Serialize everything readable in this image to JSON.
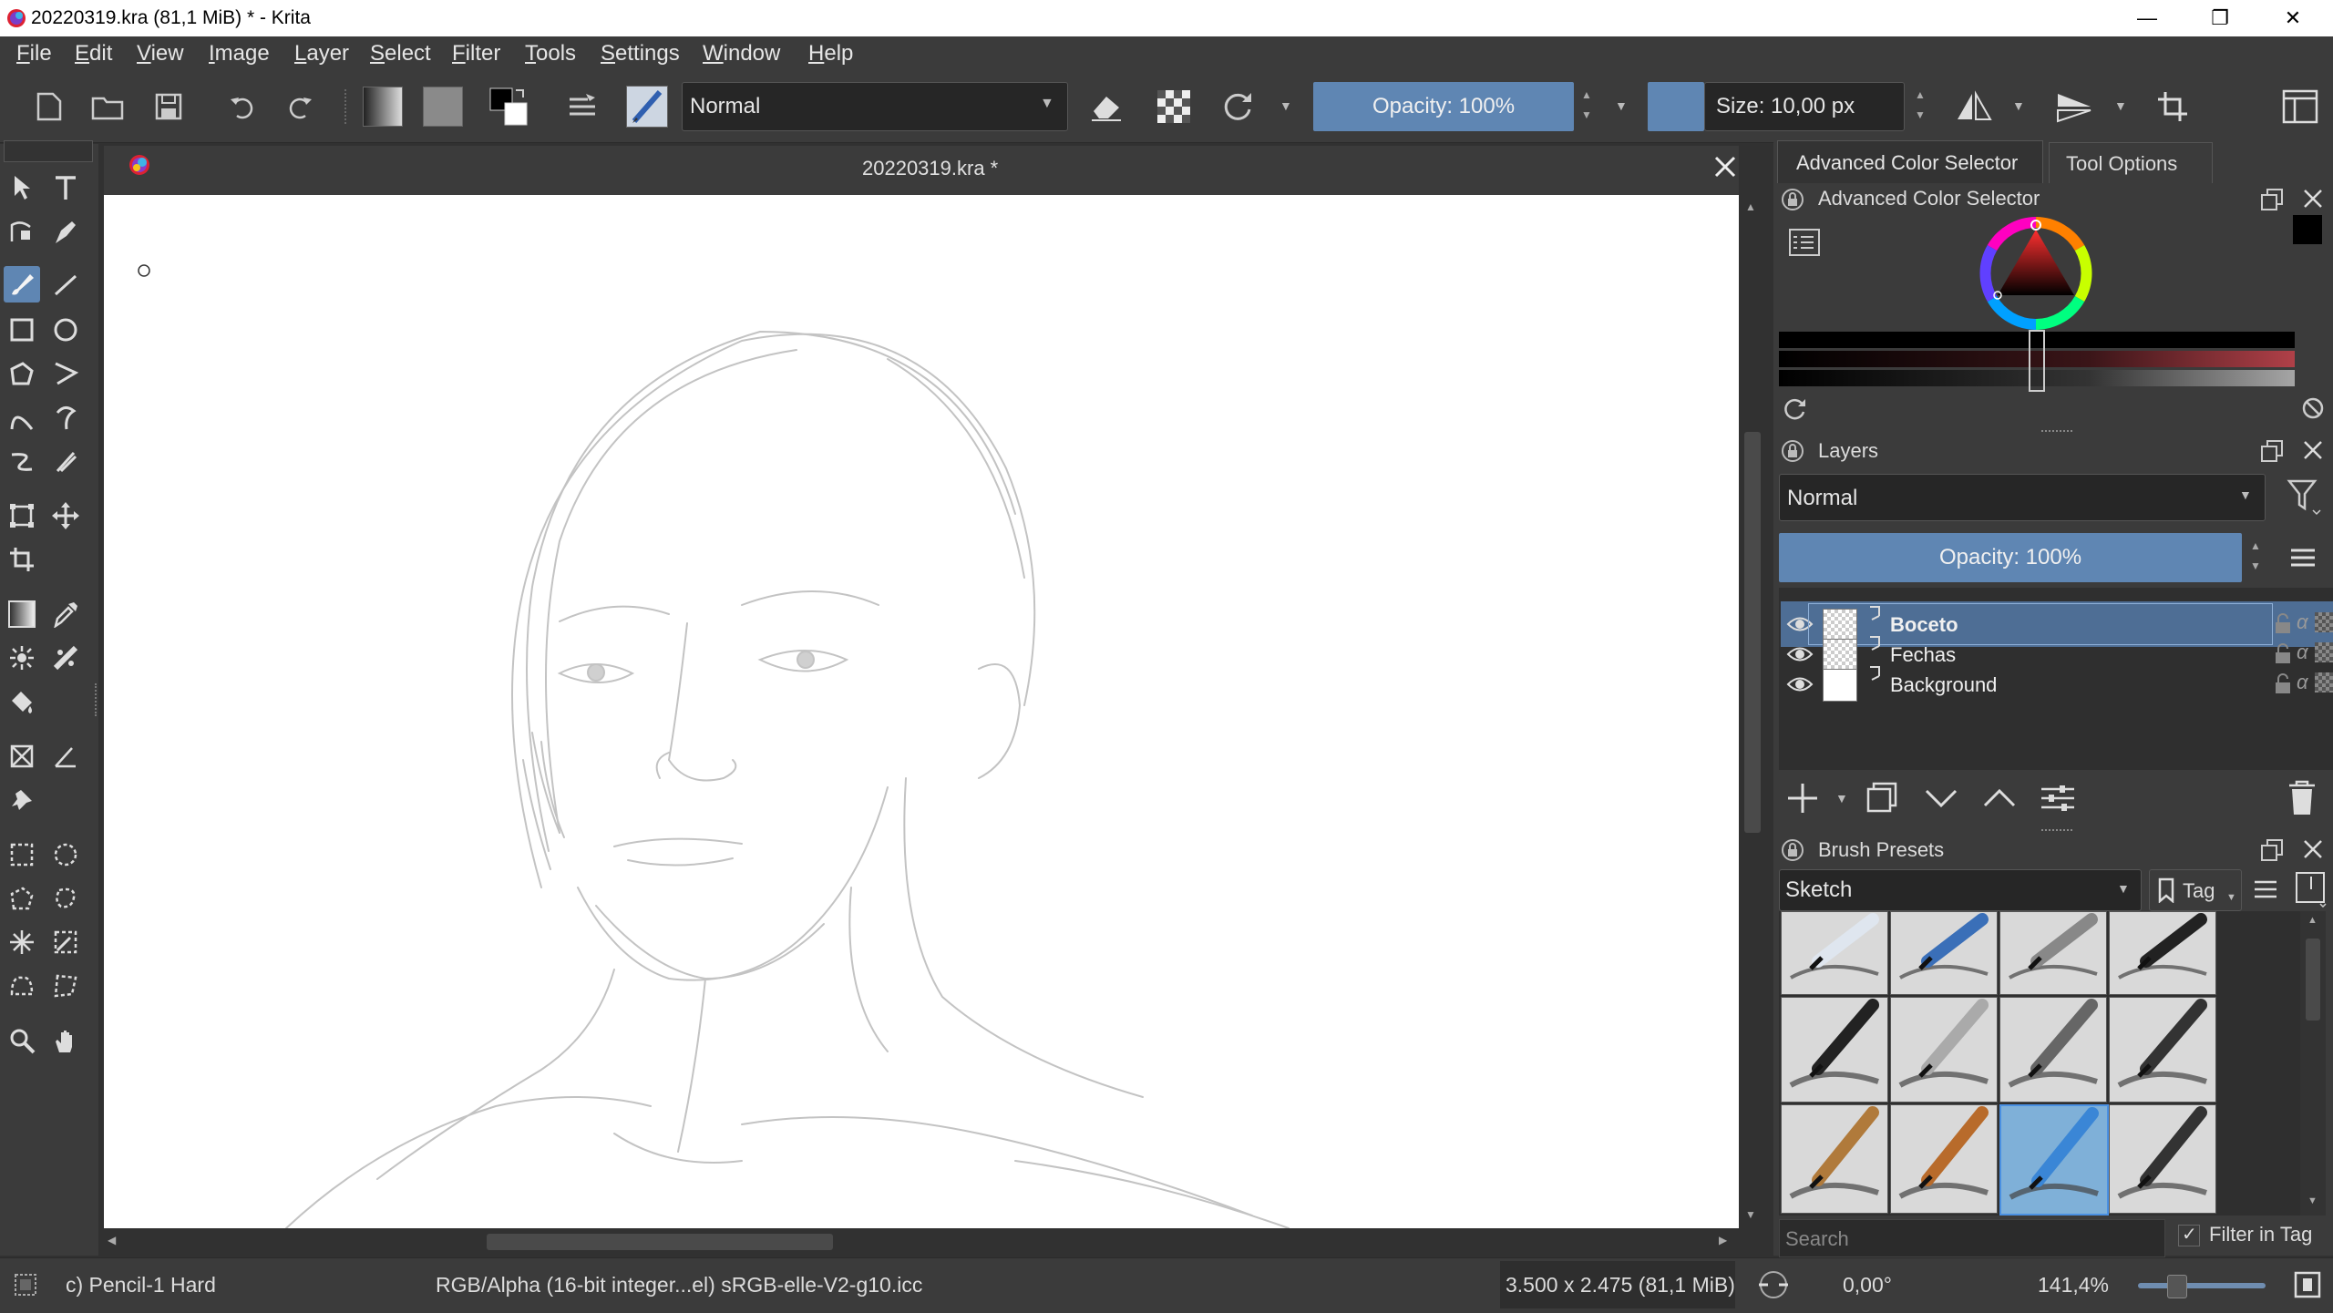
{
  "window": {
    "title": "20220319.kra (81,1 MiB)  * - Krita"
  },
  "menu": [
    "File",
    "Edit",
    "View",
    "Image",
    "Layer",
    "Select",
    "Filter",
    "Tools",
    "Settings",
    "Window",
    "Help"
  ],
  "toolbar": {
    "blend_mode": "Normal",
    "opacity_label": "Opacity: 100%",
    "size_label": "Size: 10,00 px"
  },
  "document": {
    "tab_title": "20220319.kra *"
  },
  "dockers": {
    "tabs": [
      "Advanced Color Selector",
      "Tool Options"
    ],
    "color_selector_title": "Advanced Color Selector",
    "layers_title": "Layers",
    "layers_blend_mode": "Normal",
    "layers_opacity": "Opacity:  100%",
    "layers": [
      {
        "name": "Boceto",
        "selected": true
      },
      {
        "name": "Fechas",
        "selected": false
      },
      {
        "name": "Background",
        "selected": false
      }
    ],
    "brush_presets_title": "Brush Presets",
    "brush_tag": "Sketch",
    "tag_button": "Tag",
    "search_placeholder": "Search",
    "filter_in_tag": "Filter in Tag",
    "filter_in_tag_checked": true
  },
  "status": {
    "brush": "c) Pencil-1 Hard",
    "color_space": "RGB/Alpha (16-bit integer...el)  sRGB-elle-V2-g10.icc",
    "image_size": "3.500 x 2.475 (81,1 MiB)",
    "rotation": "0,00°",
    "zoom": "141,4%",
    "zoom_level": 0.3
  },
  "colors": {
    "accent": "#5f86b3",
    "panel": "#3b3b3b",
    "background": "#313131"
  }
}
